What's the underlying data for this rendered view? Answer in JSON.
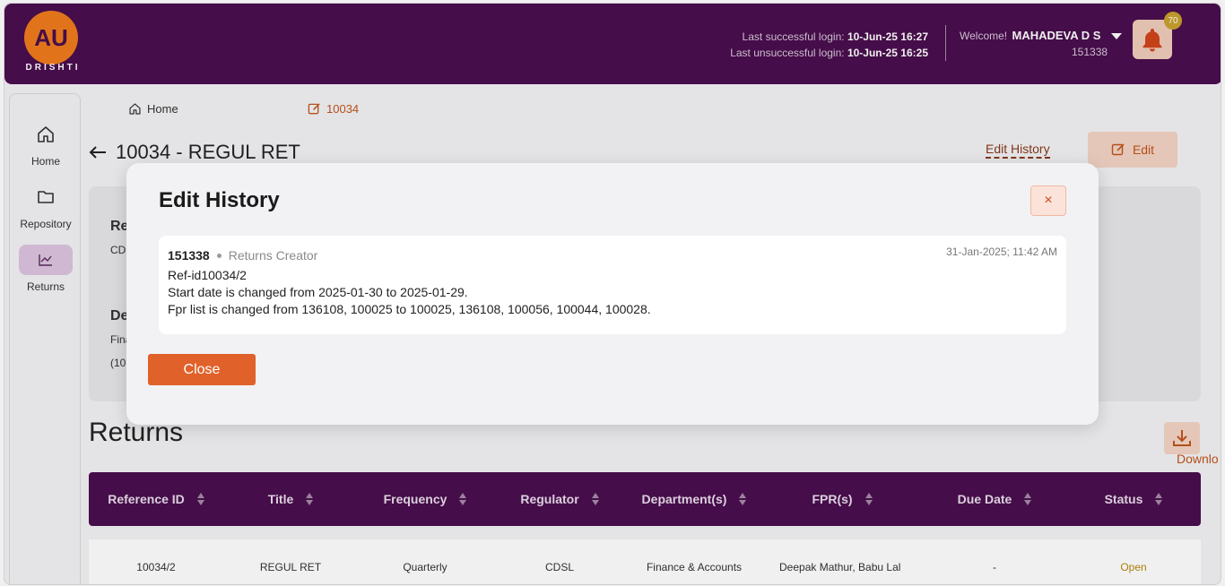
{
  "header": {
    "logo_letters": "AU",
    "logo_caption": "DRISHTI",
    "last_success_label": "Last successful login:",
    "last_success_value": "10-Jun-25 16:27",
    "last_fail_label": "Last unsuccessful login:",
    "last_fail_value": "10-Jun-25 16:25",
    "welcome_label": "Welcome!",
    "user_name": "MAHADEVA D S",
    "user_id": "151338",
    "notification_count": "70"
  },
  "sidebar": {
    "items": [
      {
        "label": "Home",
        "icon": "home-icon"
      },
      {
        "label": "Repository",
        "icon": "folder-icon"
      },
      {
        "label": "Returns",
        "icon": "chart-icon",
        "active": true
      }
    ]
  },
  "breadcrumb": {
    "home": "Home",
    "current": "10034"
  },
  "page": {
    "title": "10034 - REGUL RET",
    "edit_history_link": "Edit History",
    "edit_button": "Edit"
  },
  "info_card": {
    "frag1": "Re",
    "frag2": "CDS",
    "frag3": "De",
    "frag4": "Fina",
    "frag5": "(10"
  },
  "returns": {
    "heading": "Returns",
    "download_label": "Downlo",
    "columns": [
      "Reference ID",
      "Title",
      "Frequency",
      "Regulator",
      "Department(s)",
      "FPR(s)",
      "Due Date",
      "Status"
    ],
    "rows": [
      {
        "ref": "10034/2",
        "title": "REGUL RET",
        "frequency": "Quarterly",
        "regulator": "CDSL",
        "department": "Finance & Accounts",
        "fpr": "Deepak Mathur, Babu Lal",
        "due": "-",
        "status": "Open"
      }
    ]
  },
  "modal": {
    "title": "Edit History",
    "close_x": "×",
    "close_button": "Close",
    "entry": {
      "user_id": "151338",
      "role": "Returns Creator",
      "timestamp": "31-Jan-2025; 11:42 AM",
      "line1": "Ref-id10034/2",
      "line2": "Start date is changed from 2025-01-30 to 2025-01-29.",
      "line3": "Fpr list is changed from 136108, 100025 to 100025, 136108, 100056, 100044, 100028."
    }
  },
  "colors": {
    "brand_purple": "#4a0e4e",
    "brand_orange": "#e0612a",
    "status_open": "#b8860b"
  }
}
